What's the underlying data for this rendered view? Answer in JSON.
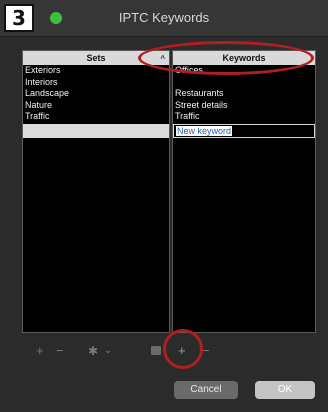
{
  "window": {
    "title": "IPTC Keywords",
    "traffic_light_color": "#3fbf3f"
  },
  "step_badge": "3",
  "sets_panel": {
    "header": "Sets",
    "sort_icon": "^",
    "items": [
      "Exteriors",
      "Interiors",
      "Landscape",
      "Nature",
      "Traffic"
    ]
  },
  "keywords_panel": {
    "header": "Keywords",
    "items": [
      "Offices",
      "",
      "Restaurants",
      "Street details",
      "Traffic"
    ],
    "edit_value": "New keyword"
  },
  "toolbar": {
    "sets_add": "+",
    "sets_remove": "−",
    "gear_icon": "✱",
    "gear_caret": "⌄",
    "keywords_add": "+",
    "keywords_remove": "−"
  },
  "buttons": {
    "cancel": "Cancel",
    "ok": "OK"
  },
  "colors": {
    "annotation_red": "#b01e22",
    "panel_header_bg": "#d9d9d9",
    "edit_text": "#1a5fbf"
  }
}
